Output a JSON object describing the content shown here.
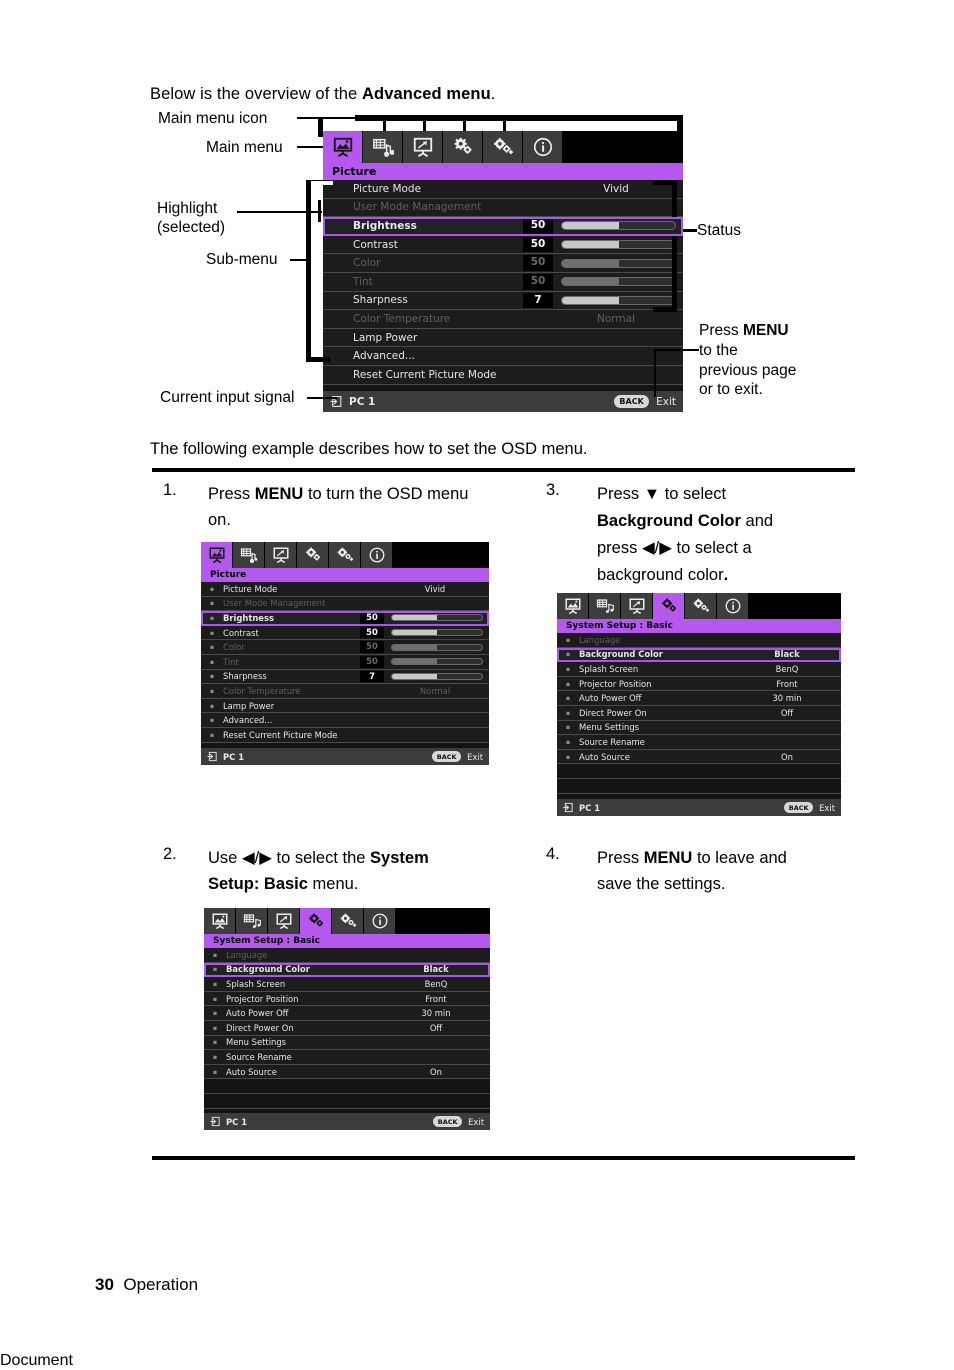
{
  "page": {
    "intro_prefix": "Below is the overview of the ",
    "intro_bold": "Advanced menu",
    "intro_suffix": ".",
    "following": "The following example describes how to set the OSD menu.",
    "footer_number": "30",
    "footer_label": "Operation"
  },
  "callouts": {
    "main_menu_icon": "Main menu icon",
    "main_menu": "Main menu",
    "highlight_line1": "Highlight",
    "highlight_line2": "(selected)",
    "sub_menu": "Sub-menu",
    "status": "Status",
    "current_input_signal": "Current input signal",
    "press_menu_1": "Press ",
    "press_menu_bold": "MENU",
    "press_menu_2": "to the",
    "press_menu_3": "previous page",
    "press_menu_4": "or to exit."
  },
  "osd_tabs": [
    {
      "name": "picture",
      "icon": "picture-screen-icon"
    },
    {
      "name": "audio",
      "icon": "audio-note-icon"
    },
    {
      "name": "display",
      "icon": "display-keystone-icon"
    },
    {
      "name": "system_setup_basic",
      "icon": "gear-basic-icon"
    },
    {
      "name": "system_setup_advanced",
      "icon": "gear-advanced-icon"
    },
    {
      "name": "information",
      "icon": "info-circle-icon"
    }
  ],
  "picture_menu": {
    "title": "Picture",
    "rows": [
      {
        "label": "Picture Mode",
        "value": "Vivid",
        "type": "value",
        "dim": false,
        "selected": false
      },
      {
        "label": "User Mode Management",
        "value": "",
        "type": "plain",
        "dim": true,
        "selected": false
      },
      {
        "label": "Brightness",
        "number": "50",
        "fill": 50,
        "type": "slider",
        "dim": false,
        "selected": true
      },
      {
        "label": "Contrast",
        "number": "50",
        "fill": 50,
        "type": "slider",
        "dim": false,
        "selected": false
      },
      {
        "label": "Color",
        "number": "50",
        "fill": 50,
        "type": "slider",
        "dim": true,
        "selected": false
      },
      {
        "label": "Tint",
        "number": "50",
        "fill": 50,
        "type": "slider",
        "dim": true,
        "selected": false
      },
      {
        "label": "Sharpness",
        "number": "7",
        "fill": 50,
        "type": "slider",
        "dim": false,
        "selected": false
      },
      {
        "label": "Color Temperature",
        "value": "Normal",
        "type": "value",
        "dim": true,
        "selected": false
      },
      {
        "label": "Lamp Power",
        "value": "",
        "type": "plain",
        "dim": false,
        "selected": false
      },
      {
        "label": "Advanced...",
        "value": "",
        "type": "plain",
        "dim": false,
        "selected": false
      },
      {
        "label": "Reset Current Picture Mode",
        "value": "",
        "type": "plain",
        "dim": false,
        "selected": false
      }
    ],
    "status": {
      "source": "PC 1",
      "back": "BACK",
      "exit": "Exit",
      "input_icon": "input-source-icon"
    }
  },
  "system_setup_menu": {
    "title": "System Setup : Basic",
    "rows": [
      {
        "label": "Language",
        "value": "",
        "dim": true,
        "selected": false
      },
      {
        "label": "Background Color",
        "value": "Black",
        "dim": false,
        "selected": true
      },
      {
        "label": "Splash Screen",
        "value": "BenQ",
        "dim": false,
        "selected": false
      },
      {
        "label": "Projector Position",
        "value": "Front",
        "dim": false,
        "selected": false
      },
      {
        "label": "Auto Power Off",
        "value": "30 min",
        "dim": false,
        "selected": false
      },
      {
        "label": "Direct Power On",
        "value": "Off",
        "dim": false,
        "selected": false
      },
      {
        "label": "Menu Settings",
        "value": "",
        "dim": false,
        "selected": false
      },
      {
        "label": "Source Rename",
        "value": "",
        "dim": false,
        "selected": false
      },
      {
        "label": "Auto Source",
        "value": "On",
        "dim": false,
        "selected": false
      }
    ],
    "empty_rows": 3,
    "status": {
      "source": "PC 1",
      "back": "BACK",
      "exit": "Exit",
      "input_icon": "input-source-icon"
    }
  },
  "steps": {
    "step1": {
      "num": "1.",
      "t1": "Press ",
      "b1": "MENU",
      "t2": " to turn the OSD menu",
      "t3": "on."
    },
    "step2": {
      "num": "2.",
      "t1": "Use ",
      "arrows": "◀/▶",
      "t2": " to select the ",
      "b1": "System",
      "b2": "Setup: Basic",
      "t3": " menu."
    },
    "step3": {
      "num": "3.",
      "t1": "Press ",
      "arrow_down": "▼",
      "t2": " to select",
      "b1": "Background Color",
      "t3": " and",
      "t4": "press ",
      "arrows": "◀/▶",
      "t5": " to select a",
      "t6": "background color",
      "t7": "."
    },
    "step4": {
      "num": "4.",
      "t1": "Press ",
      "b1": "MENU",
      "t2": " to leave and",
      "t3": "save the settings."
    }
  },
  "colors": {
    "accent_purple": "#b558ee",
    "selection_outline": "#a855f7",
    "osd_background": "#0a0a0a",
    "row_background": "#1c1c1c",
    "status_bar": "#3c3c3c"
  }
}
